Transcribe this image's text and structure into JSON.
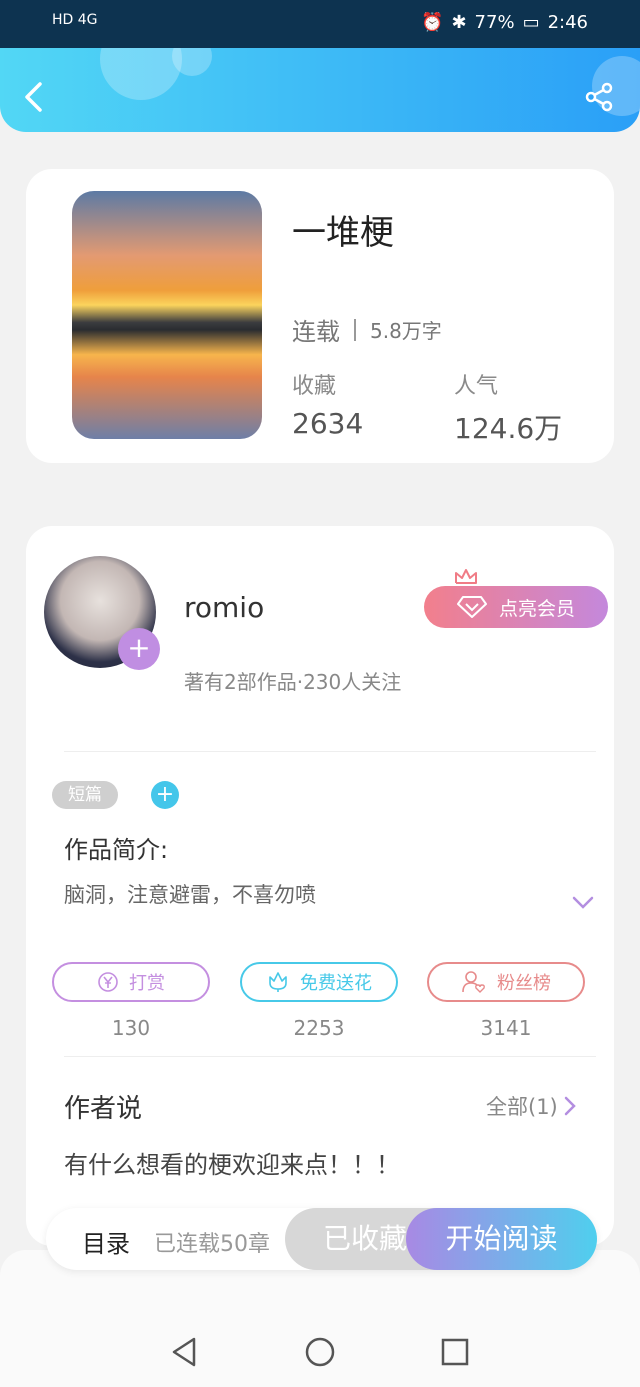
{
  "status_bar": {
    "network": "HD 4G",
    "battery": "77%",
    "time": "2:46"
  },
  "book": {
    "title": "一堆梗",
    "serial_status": "连载",
    "word_count": "5.8万字",
    "favorites_label": "收藏",
    "favorites_value": "2634",
    "popularity_label": "人气",
    "popularity_value": "124.6万"
  },
  "author": {
    "name": "romio",
    "meta": "著有2部作品·230人关注",
    "vip_label": "点亮会员"
  },
  "details": {
    "tag": "短篇",
    "tag_add": "+",
    "intro_heading": "作品简介:",
    "intro_text": "脑洞，注意避雷，不喜勿喷"
  },
  "actions": [
    {
      "label": "打赏",
      "count": "130",
      "color": "#c48fe0"
    },
    {
      "label": "免费送花",
      "count": "2253",
      "color": "#47c9e8"
    },
    {
      "label": "粉丝榜",
      "count": "3141",
      "color": "#e78b8b"
    }
  ],
  "author_says": {
    "heading": "作者说",
    "all_label": "全部(1)",
    "text": "有什么想看的梗欢迎来点！！！"
  },
  "bottom_bar": {
    "catalog": "目录",
    "chapters": "已连载50章",
    "favorited": "已收藏",
    "start_reading": "开始阅读"
  }
}
